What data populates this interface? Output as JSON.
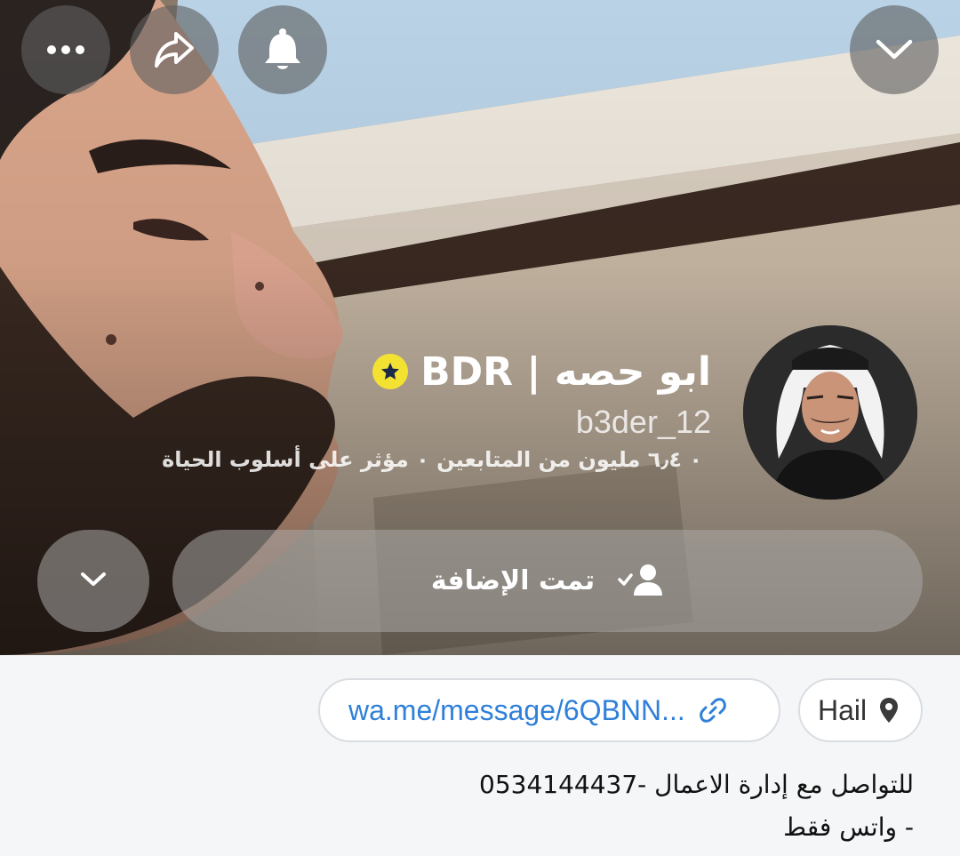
{
  "profile": {
    "display_name": "ابو حصه | BDR",
    "username": "b3der_12",
    "meta": "٠ ٦٫٤ مليون من المتابعين ٠ مؤثر على أسلوب الحياة",
    "badge_icon": "star-badge-icon",
    "badge_color": "#f3e232"
  },
  "top_bar": {
    "more_icon": "more-horizontal-icon",
    "share_icon": "share-icon",
    "notification_icon": "bell-icon",
    "collapse_icon": "chevron-down-icon"
  },
  "actions": {
    "added_label": "تمت الإضافة",
    "added_icon": "user-check-icon",
    "more_icon": "chevron-down-icon"
  },
  "info": {
    "location": "Hail",
    "location_icon": "location-pin-icon",
    "link": "wa.me/message/6QBNN...",
    "link_icon": "link-icon",
    "link_color": "#2f80d9",
    "bio_lines": [
      "للتواصل مع إدارة الاعمال -0534144437",
      "- واتس فقط"
    ]
  }
}
